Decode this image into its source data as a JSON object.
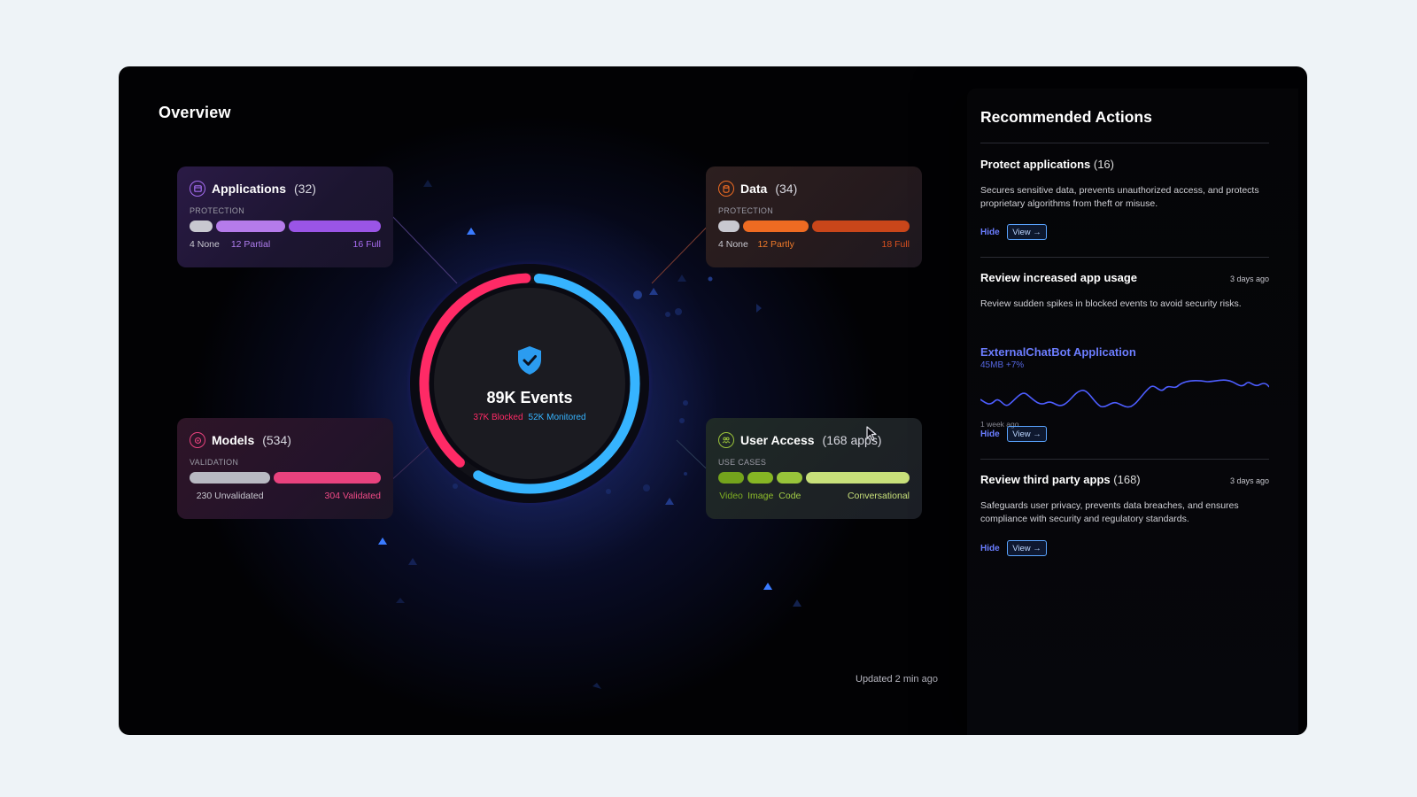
{
  "overview": {
    "title": "Overview",
    "updated": "Updated 2 min ago"
  },
  "summary": {
    "events": "89K Events",
    "blocked": "37K Blocked",
    "monitored": "52K Monitored",
    "blocked_value": 37,
    "monitored_value": 52,
    "colors": {
      "blocked": "#ff2a66",
      "monitored": "#36b4ff"
    }
  },
  "cards": {
    "applications": {
      "title": "Applications",
      "count": "(32)",
      "sub": "PROTECTION",
      "icon": "app-window-icon",
      "segments": [
        {
          "label": "4 None",
          "value": 4,
          "color": "#c8c8d0",
          "text": "#c8c8d0"
        },
        {
          "label": "12 Partial",
          "value": 12,
          "color": "#b57bea",
          "text": "#b07ef0"
        },
        {
          "label": "16 Full",
          "value": 16,
          "color": "#9a55e6",
          "text": "#a86cf2"
        }
      ]
    },
    "data": {
      "title": "Data",
      "count": "(34)",
      "sub": "PROTECTION",
      "icon": "database-icon",
      "segments": [
        {
          "label": "4 None",
          "value": 4,
          "color": "#c8c8d0",
          "text": "#c8c8d0"
        },
        {
          "label": "12 Partly",
          "value": 12,
          "color": "#ee6b22",
          "text": "#f07a2a"
        },
        {
          "label": "18 Full",
          "value": 18,
          "color": "#c9461a",
          "text": "#d8501f"
        }
      ]
    },
    "models": {
      "title": "Models",
      "count": "(534)",
      "sub": "VALIDATION",
      "icon": "model-target-icon",
      "segments": [
        {
          "label": "230 Unvalidated",
          "value": 230,
          "color": "#b8b9c2",
          "text": "#c8c8d0"
        },
        {
          "label": "304 Validated",
          "value": 304,
          "color": "#e9427e",
          "text": "#f04a86"
        }
      ]
    },
    "user_access": {
      "title": "User Access",
      "count": "(168 apps)",
      "sub": "USE CASES",
      "icon": "users-icon",
      "segments": [
        {
          "label": "Video",
          "value": 1,
          "color": "#74a31c",
          "text": "#7faf22"
        },
        {
          "label": "Image",
          "value": 1,
          "color": "#86b624",
          "text": "#8fbd2a"
        },
        {
          "label": "Code",
          "value": 1,
          "color": "#98c43a",
          "text": "#a2cc46"
        },
        {
          "label": "Conversational",
          "value": 4,
          "color": "#c8e07a",
          "text": "#c8e07a"
        }
      ]
    }
  },
  "panel": {
    "title": "Recommended Actions",
    "actions": [
      {
        "title": "Protect applications",
        "count": "(16)",
        "age": "",
        "desc": "Secures sensitive data, prevents unauthorized access, and protects proprietary algorithms from theft or misuse.",
        "hide": "Hide",
        "view": "View →"
      },
      {
        "title": "Review increased app usage",
        "count": "",
        "age": "3 days ago",
        "desc": "Review sudden spikes in blocked events to avoid security risks.",
        "hide": "Hide",
        "view": "View →",
        "app": {
          "name": "ExternalChatBot Application",
          "meta": "45MB +7%",
          "since": "1 week ago"
        }
      },
      {
        "title": "Review third party apps",
        "count": "(168)",
        "age": "3 days ago",
        "desc": "Safeguards user privacy, prevents data breaches, and ensures compliance with security and regulatory standards.",
        "hide": "Hide",
        "view": "View →"
      }
    ]
  }
}
